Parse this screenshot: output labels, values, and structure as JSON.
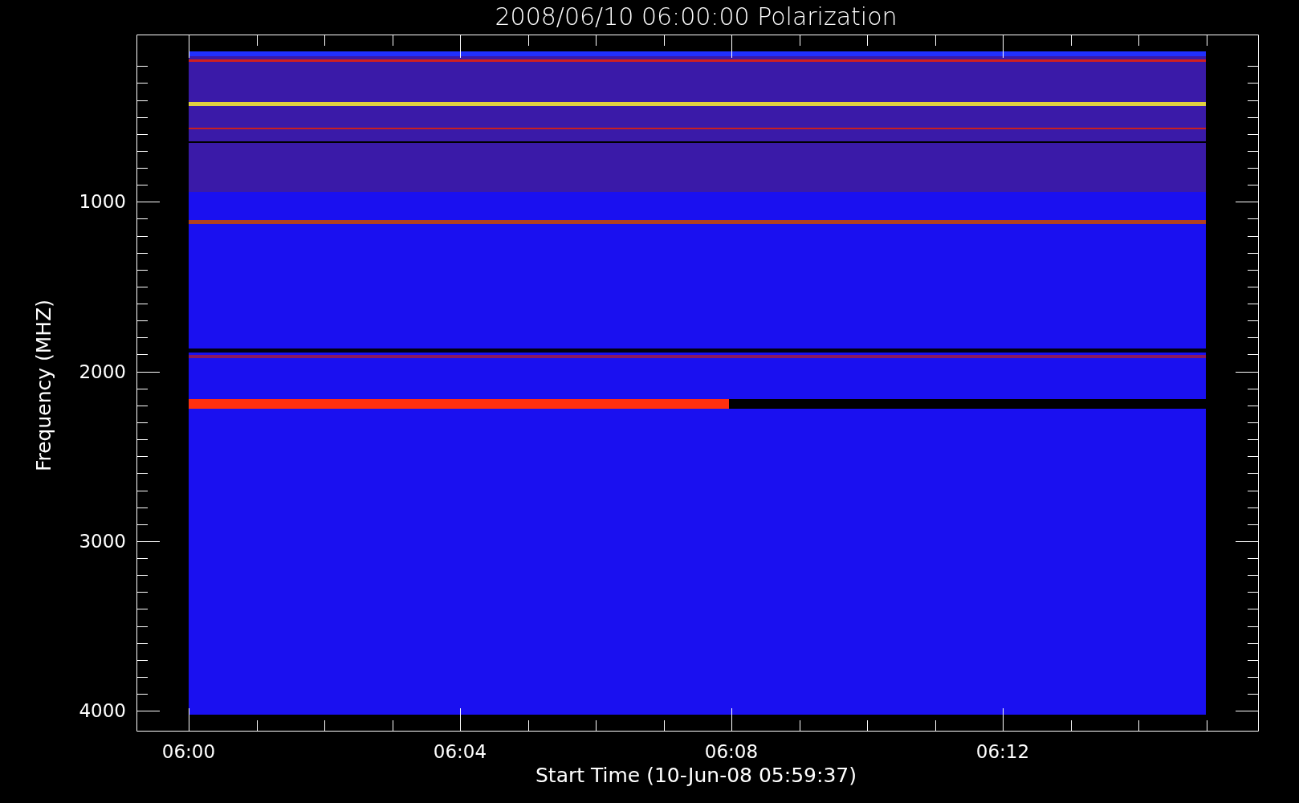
{
  "plot": {
    "title": "2008/06/10 06:00:00 Polarization",
    "y_axis": {
      "label": "Frequency (MHZ)",
      "ticks": [
        "1000",
        "2000",
        "3000",
        "4000"
      ]
    },
    "x_axis": {
      "label": "Start Time (10-Jun-08 05:59:37)",
      "ticks": [
        "06:00",
        "06:04",
        "06:08",
        "06:12"
      ]
    }
  }
}
